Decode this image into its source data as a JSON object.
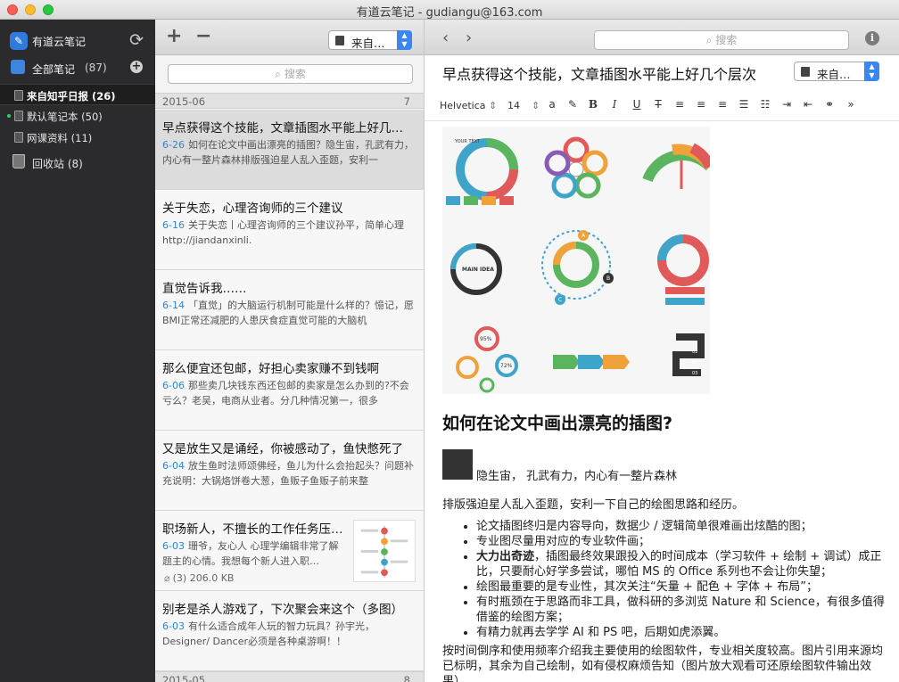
{
  "window": {
    "title": "有道云笔记 - gudiangu@163.com"
  },
  "sidebar": {
    "app_name": "有道云笔记",
    "all_notes_label": "全部笔记",
    "all_notes_count": "(87)",
    "notebooks": [
      {
        "label": "来自知乎日报 (26)",
        "active": true
      },
      {
        "label": "默认笔记本 (50)",
        "active": false
      },
      {
        "label": "网课资料 (11)",
        "active": false
      }
    ],
    "trash_label": "回收站 (8)"
  },
  "list": {
    "notebook_select": "来自…",
    "search_placeholder": "搜索",
    "groups": [
      {
        "date": "2015-06",
        "count": "7"
      },
      {
        "date": "2015-05",
        "count": "8"
      }
    ],
    "notes": [
      {
        "title": "早点获得这个技能，文章插图水平能上好几…",
        "date": "6-26",
        "preview": "如何在论文中画出漂亮的插图？隐生宙，孔武有力，内心有一整片森林排版强迫星人乱入歪题，安利一"
      },
      {
        "title": "关于失恋，心理咨询师的三个建议",
        "date": "6-16",
        "preview": "关于失恋丨心理咨询师的三个建议孙平，简单心理 http://jiandanxinli."
      },
      {
        "title": "直觉告诉我……",
        "date": "6-14",
        "preview": "「直觉」的大脑运行机制可能是什么样的？憶记，愿BMI正常还减肥的人患厌食症直觉可能的大脑机"
      },
      {
        "title": "那么便宜还包邮，好担心卖家赚不到钱啊",
        "date": "6-06",
        "preview": "那些卖几块钱东西还包邮的卖家是怎么办到的?不会亏么？老吴，电商从业者。分几种情况第一，很多"
      },
      {
        "title": "又是放生又是诵经，你被感动了，鱼快憋死了",
        "date": "6-04",
        "preview": "放生鱼时法师颂佛经，鱼儿为什么会抬起头？问题补充说明：大锅烙饼卷大葱，鱼贩子鱼贩子前来整"
      },
      {
        "title": "职场新人，不擅长的工作任务压…",
        "date": "6-03",
        "preview": "珊爷，友心人 心理学编辑非常了解题主的心情。我想每个新人进入职…",
        "attachment": "(3) 206.0 KB"
      },
      {
        "title": "别老是杀人游戏了，下次聚会来这个（多图）",
        "date": "6-03",
        "preview": "有什么适合成年人玩的智力玩具？孙宇光，Designer/ Dancer必须是各种桌游啊！！"
      }
    ]
  },
  "editor": {
    "search_placeholder": "搜索",
    "note_title": "早点获得这个技能，文章插图水平能上好几个层次",
    "notebook_select": "来自…",
    "font_family": "Helvetica",
    "font_size": "14",
    "heading": "如何在论文中画出漂亮的插图?",
    "author_line": "隐生宙，  孔武有力，内心有一整片森林",
    "intro": "排版强迫星人乱入歪题，安利一下自己的绘图思路和经历。",
    "bullets": [
      "论文插图终归是内容导向，数据少 / 逻辑简单很难画出炫酷的图；",
      "专业图尽量用对应的专业软件画；",
      "大力出奇迹，插图最终效果跟投入的时间成本（学习软件 + 绘制 + 调试）成正比，只要耐心好学多尝试，哪怕 MS 的 Office 系列也不会让你失望；",
      "绘图最重要的是专业性，其次关注“矢量 + 配色 + 字体 + 布局”；",
      "有时瓶颈在于思路而非工具，做科研的多浏览 Nature 和 Science，有很多值得借鉴的绘图方案；",
      "有精力就再去学学 AI 和 PS 吧，后期如虎添翼。"
    ],
    "bullet3_bold": "大力出奇迹",
    "para2": "按时间倒序和使用频率介绍我主要使用的绘图软件，专业相关度较高。图片引用来源均已标明，其余为自己绘制，如有侵权麻烦告知（图片放大观看可还原绘图软件输出效果）。",
    "image_text": [
      "YOUR TEXT",
      "MAIN IDEA",
      "95%",
      "72%",
      "A",
      "B",
      "C",
      "01",
      "02",
      "03"
    ]
  },
  "colors": {
    "accent": "#3a87f3",
    "date_blue": "#2f86d4",
    "sidebar_bg": "#2b2b2d",
    "green_dot": "#3bc66b"
  }
}
